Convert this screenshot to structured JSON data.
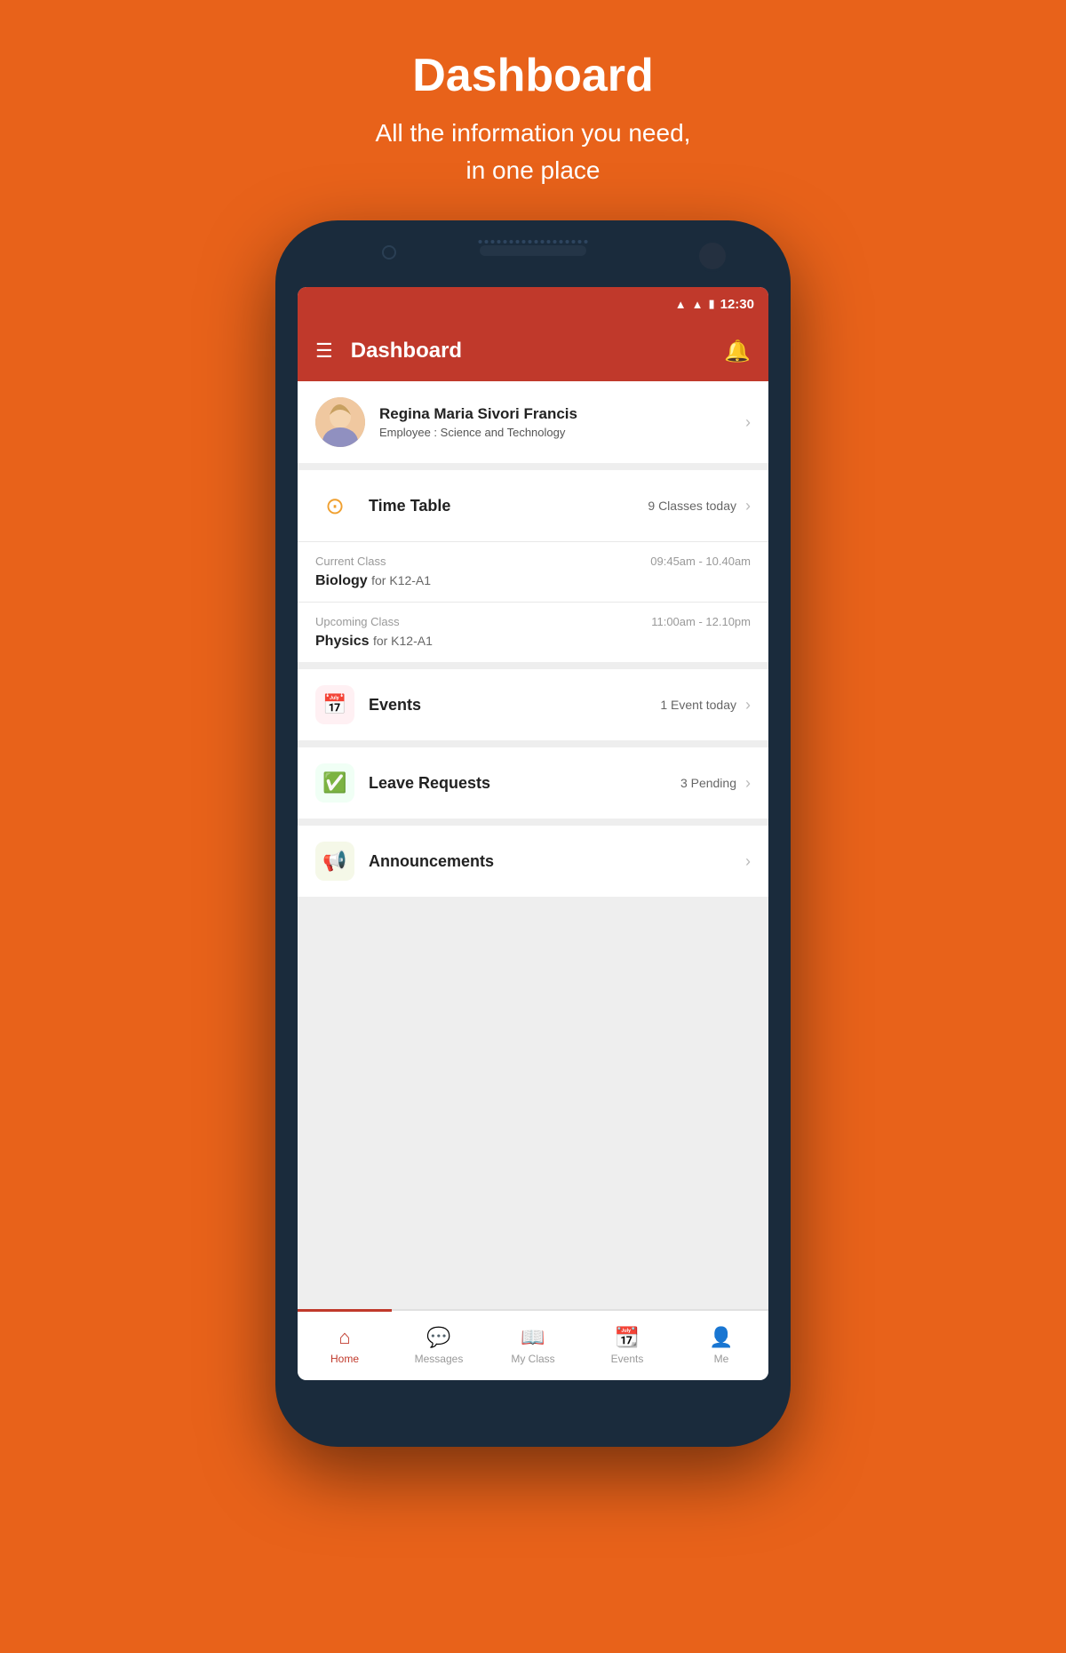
{
  "pageHeader": {
    "title": "Dashboard",
    "subtitle": "All the information you need,\nin one place"
  },
  "statusBar": {
    "time": "12:30"
  },
  "appBar": {
    "title": "Dashboard"
  },
  "profile": {
    "name": "Regina Maria Sivori Francis",
    "roleLabel": "Employee : ",
    "roleDept": "Science and Technology"
  },
  "timetable": {
    "icon": "🕐",
    "title": "Time Table",
    "badge": "9 Classes today",
    "currentClass": {
      "label": "Current Class",
      "time": "09:45am - 10.40am",
      "name": "Biology",
      "group": "for K12-A1"
    },
    "upcomingClass": {
      "label": "Upcoming Class",
      "time": "11:00am - 12.10pm",
      "name": "Physics",
      "group": "for K12-A1"
    }
  },
  "events": {
    "title": "Events",
    "badge": "1 Event today"
  },
  "leaveRequests": {
    "title": "Leave Requests",
    "badge": "3 Pending"
  },
  "announcements": {
    "title": "Announcements",
    "badge": ""
  },
  "bottomNav": {
    "items": [
      {
        "label": "Home",
        "active": true
      },
      {
        "label": "Messages",
        "active": false
      },
      {
        "label": "My Class",
        "active": false
      },
      {
        "label": "Events",
        "active": false
      },
      {
        "label": "Me",
        "active": false
      }
    ]
  }
}
